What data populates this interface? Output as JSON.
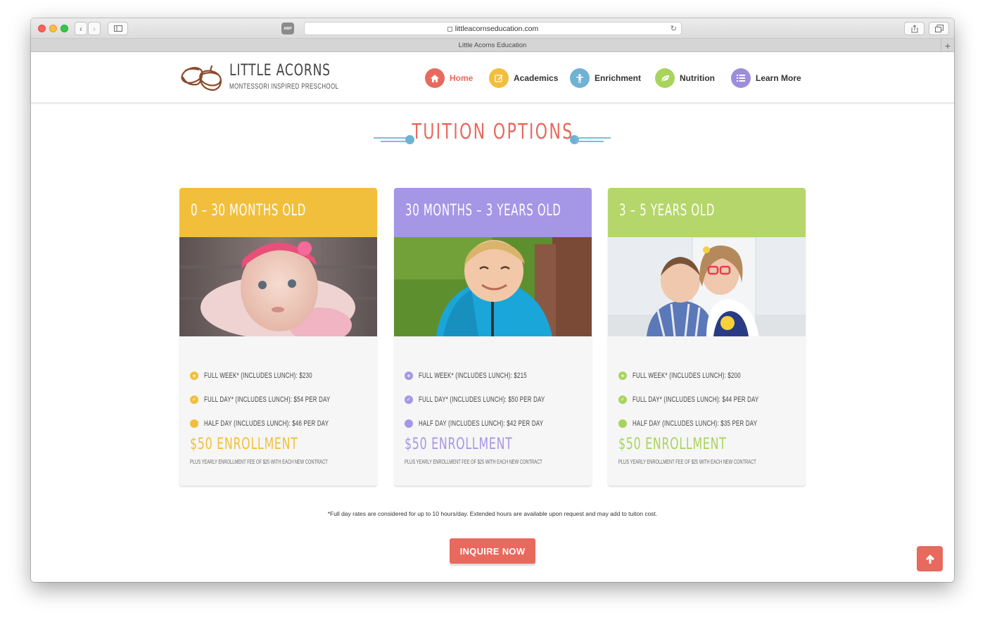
{
  "browser": {
    "url": "littleacornseducation.com",
    "tab_title": "Little Acorns Education",
    "adblock_label": "ABP"
  },
  "site": {
    "logo_title": "LITTLE ACORNS",
    "logo_subtitle": "MONTESSORI INSPIRED PRESCHOOL",
    "nav": [
      {
        "label": "Home",
        "icon": "home-icon",
        "color": "#e8695d",
        "active": true
      },
      {
        "label": "Academics",
        "icon": "pencil-icon",
        "color": "#f2bf3c",
        "active": false
      },
      {
        "label": "Enrichment",
        "icon": "person-icon",
        "color": "#6fb2d3",
        "active": false
      },
      {
        "label": "Nutrition",
        "icon": "leaf-icon",
        "color": "#a8d45c",
        "active": false
      },
      {
        "label": "Learn More",
        "icon": "list-icon",
        "color": "#9d8ddd",
        "active": false
      }
    ]
  },
  "main": {
    "title": "TUITION OPTIONS",
    "cards": [
      {
        "heading": "0 – 30 MONTHS OLD",
        "color": "#f2bf3c",
        "items": [
          "FULL WEEK* (INCLUDES LUNCH): $230",
          "FULL DAY* (INCLUDES LUNCH): $54 PER DAY",
          "HALF DAY (INCLUDES LUNCH): $46 PER DAY"
        ],
        "enrollment": "$50 ENROLLMENT",
        "enrollment_note": "PLUS YEARLY ENROLLMENT FEE OF $25 WITH EACH NEW CONTRACT"
      },
      {
        "heading": "30 MONTHS – 3 YEARS OLD",
        "color": "#a696e6",
        "items": [
          "FULL WEEK* (INCLUDES LUNCH): $215",
          "FULL DAY* (INCLUDES LUNCH): $50 PER DAY",
          "HALF DAY (INCLUDES LUNCH): $42 PER DAY"
        ],
        "enrollment": "$50 ENROLLMENT",
        "enrollment_note": "PLUS YEARLY ENROLLMENT FEE OF $25 WITH EACH NEW CONTRACT"
      },
      {
        "heading": "3 – 5 YEARS OLD",
        "color": "#b5d66a",
        "items": [
          "FULL WEEK* (INCLUDES LUNCH): $200",
          "FULL DAY* (INCLUDES LUNCH): $44 PER DAY",
          "HALF DAY (INCLUDES LUNCH): $35 PER DAY"
        ],
        "enrollment": "$50 ENROLLMENT",
        "enrollment_note": "PLUS YEARLY ENROLLMENT FEE OF $25 WITH EACH NEW CONTRACT"
      }
    ],
    "footnote": "*Full day rates are considered for up to 10 hours/day. Extended hours are available upon request and may add to tuiton cost.",
    "cta_label": "INQUIRE NOW",
    "scroll_top_icon": "arrow-up-icon"
  }
}
